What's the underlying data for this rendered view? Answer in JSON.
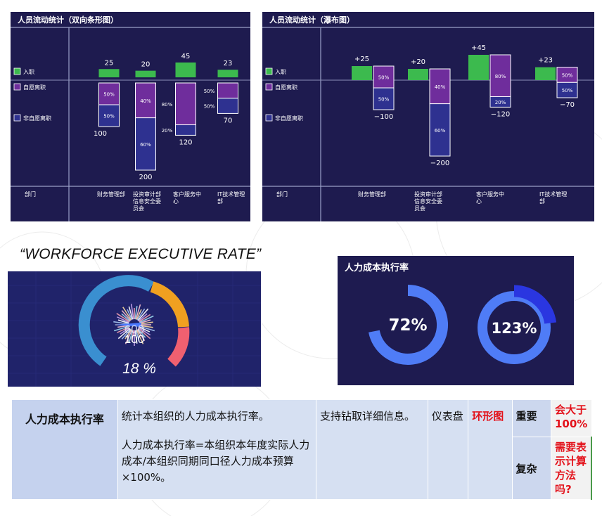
{
  "page": {
    "quote": "“WORKFORCE EXECUTIVE RATE”"
  },
  "chart_data": [
    {
      "type": "bar",
      "title": "人员流动统计（双向条形图）",
      "legend": [
        "入职",
        "自愿离职",
        "非自愿离职"
      ],
      "xlabel": "部门",
      "categories": [
        "财务管理部",
        "投资审计部信息安全委员会",
        "客户服务中心",
        "IT技术管理部"
      ],
      "category_lines": [
        [
          "财务管理部"
        ],
        [
          "投资审计部",
          "信息安全委",
          "员会"
        ],
        [
          "客户服务中",
          "心"
        ],
        [
          "IT技术管理",
          "部"
        ]
      ],
      "series": [
        {
          "name": "入职",
          "values": [
            25,
            20,
            45,
            23
          ],
          "labels": [
            "25",
            "20",
            "45",
            "23"
          ]
        },
        {
          "name": "自愿离职",
          "shares": [
            "50%",
            "40%",
            "80%",
            "50%"
          ],
          "share_values": [
            0.5,
            0.4,
            0.8,
            0.5
          ]
        },
        {
          "name": "非自愿离职",
          "shares": [
            "50%",
            "60%",
            "20%",
            "50%"
          ],
          "share_values": [
            0.5,
            0.6,
            0.2,
            0.5
          ]
        }
      ],
      "leave_totals": [
        100,
        200,
        120,
        70
      ],
      "leave_labels": [
        "100",
        "200",
        "120",
        "70"
      ],
      "colors": {
        "入职": "#3cba4e",
        "自愿离职": "#6f2d9c",
        "非自愿离职": "#2e3190"
      }
    },
    {
      "type": "bar",
      "title": "人员流动统计（瀑布图）",
      "legend": [
        "入职",
        "自愿离职",
        "非自愿离职"
      ],
      "xlabel": "部门",
      "categories": [
        "财务管理部",
        "投资审计部信息安全委员会",
        "客户服务中心",
        "IT技术管理部"
      ],
      "category_lines": [
        [
          "财务管理部"
        ],
        [
          "投资审计部",
          "信息安全委",
          "员会"
        ],
        [
          "客户服务中",
          "心"
        ],
        [
          "IT技术管理",
          "部"
        ]
      ],
      "series": [
        {
          "name": "入职",
          "values": [
            25,
            20,
            45,
            23
          ],
          "labels": [
            "+25",
            "+20",
            "+45",
            "+23"
          ]
        },
        {
          "name": "自愿离职",
          "shares": [
            "50%",
            "40%",
            "80%",
            "50%"
          ],
          "share_values": [
            0.5,
            0.4,
            0.8,
            0.5
          ]
        },
        {
          "name": "非自愿离职",
          "shares": [
            "50%",
            "60%",
            "20%",
            "50%"
          ],
          "share_values": [
            0.5,
            0.6,
            0.2,
            0.5
          ]
        }
      ],
      "leave_totals": [
        100,
        200,
        120,
        70
      ],
      "leave_labels": [
        "−100",
        "−200",
        "−120",
        "−70"
      ]
    },
    {
      "type": "gauge",
      "readout_top": "600",
      "readout_main": "100",
      "value_text": "18 %",
      "colors": [
        "#3a8fd0",
        "#f0a020",
        "#f06070"
      ]
    },
    {
      "type": "pie",
      "title": "人力成本执行率",
      "rings": [
        {
          "label": "72%",
          "value": 72
        },
        {
          "label": "123%",
          "value": 123
        }
      ],
      "colors": {
        "ring": "#4f7cf6",
        "overflow": "#2a36e0"
      }
    }
  ],
  "table": {
    "name": "人力成本执行率",
    "desc1": "统计本组织的人力成本执行率。",
    "desc2": "人力成本执行率=本组织本年度实际人力成本/本组织同期同口径人力成本预算×100%。",
    "drill": "支持钻取详细信息。",
    "type": "仪表盘",
    "chart": "环形图",
    "importance": "重要",
    "complexity": "复杂",
    "note1": "会大于100%",
    "note2": "需要表示计算方法吗?"
  }
}
